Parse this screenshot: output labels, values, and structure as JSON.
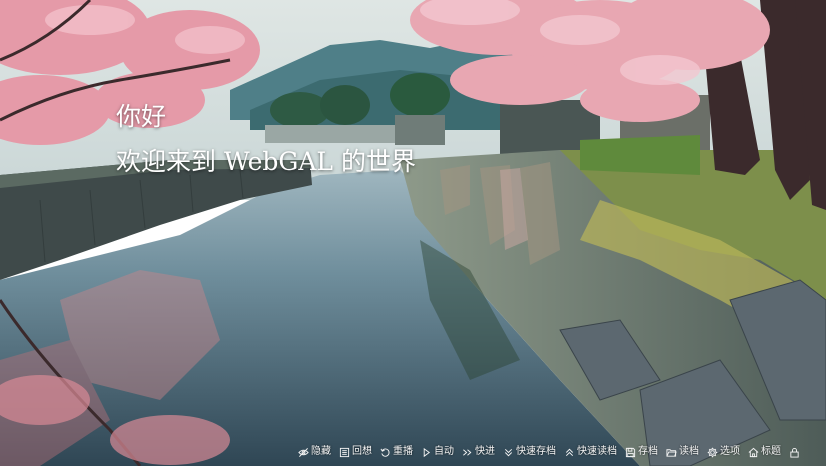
{
  "dialog": {
    "line1": "你好",
    "line2": "欢迎来到 WebGAL 的世界"
  },
  "controls": [
    {
      "icon": "eye-off-icon",
      "label": "隐藏"
    },
    {
      "icon": "backlog-icon",
      "label": "回想"
    },
    {
      "icon": "replay-icon",
      "label": "重播"
    },
    {
      "icon": "play-icon",
      "label": "自动"
    },
    {
      "icon": "fast-forward-icon",
      "label": "快进"
    },
    {
      "icon": "chevron-down-double-icon",
      "label": "快速存档"
    },
    {
      "icon": "chevron-up-double-icon",
      "label": "快速读档"
    },
    {
      "icon": "save-icon",
      "label": "存档"
    },
    {
      "icon": "folder-open-icon",
      "label": "读档"
    },
    {
      "icon": "gear-icon",
      "label": "选项"
    },
    {
      "icon": "home-icon",
      "label": "标题"
    },
    {
      "icon": "lock-icon",
      "label": ""
    }
  ]
}
